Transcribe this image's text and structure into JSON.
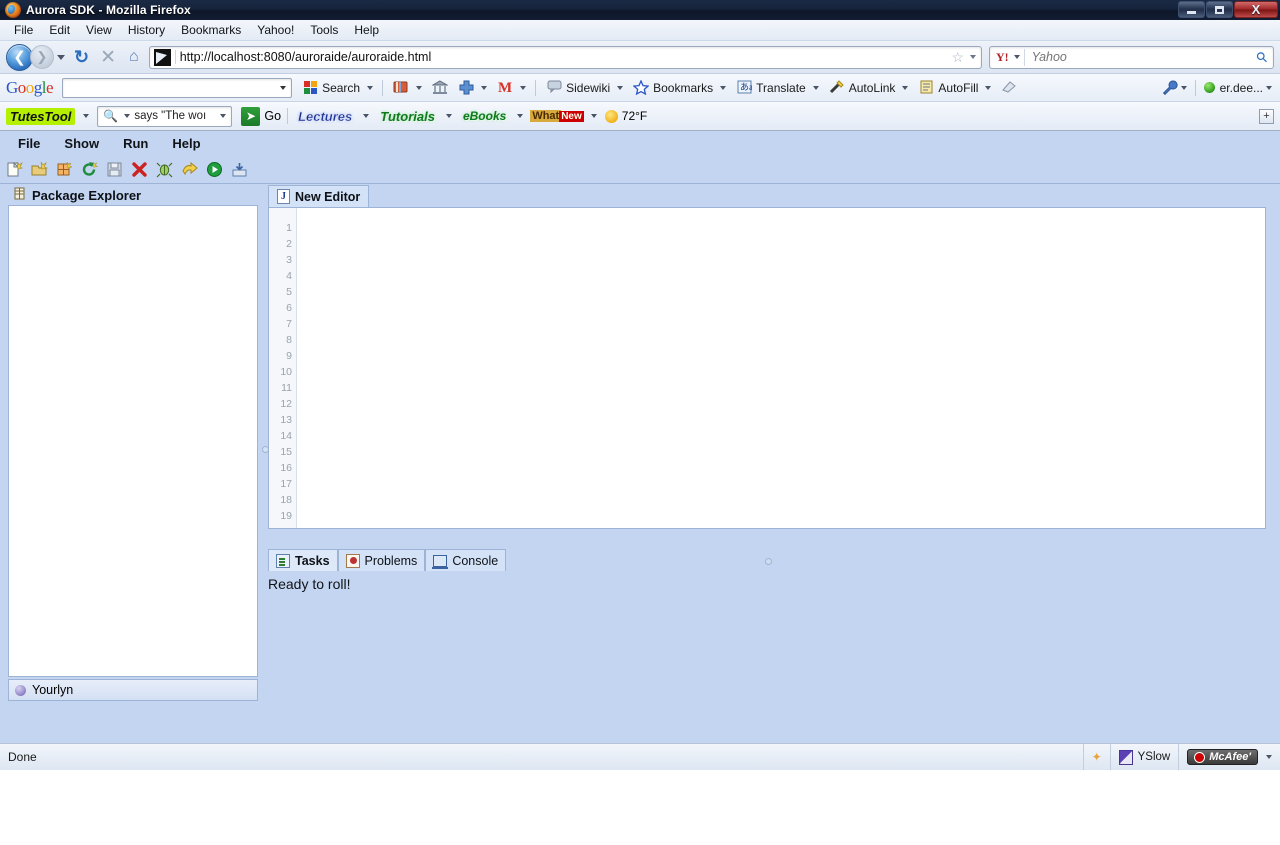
{
  "window": {
    "title": "Aurora SDK - Mozilla Firefox",
    "app_icon": "firefox-icon",
    "controls": {
      "minimize": "–",
      "maximize": "❐",
      "close": "X"
    }
  },
  "browser": {
    "menubar": [
      {
        "label": "File"
      },
      {
        "label": "Edit"
      },
      {
        "label": "View"
      },
      {
        "label": "History"
      },
      {
        "label": "Bookmarks"
      },
      {
        "label": "Yahoo!"
      },
      {
        "label": "Tools"
      },
      {
        "label": "Help"
      }
    ],
    "nav": {
      "back_icon": "❮",
      "forward_icon": "❯",
      "reload_icon": "↻",
      "stop_icon": "✕",
      "home_icon": "⌂",
      "url": "http://localhost:8080/auroraide/auroraide.html",
      "star_icon": "☆"
    },
    "search": {
      "engine": "Yahoo!",
      "engine_icon": "Y!",
      "placeholder": "Yahoo",
      "value": "",
      "go_icon": "⚲"
    }
  },
  "google_toolbar": {
    "logo": {
      "g1": "G",
      "o1": "o",
      "o2": "o",
      "g2": "g",
      "l": "l",
      "e": "e"
    },
    "search_value": "",
    "items": [
      {
        "label": "Search",
        "icon": "google-g-icon"
      },
      {
        "label": "",
        "icon": "bookmarks-book-icon"
      },
      {
        "label": "",
        "icon": "bank-icon"
      },
      {
        "label": "",
        "icon": "plus-box-icon"
      },
      {
        "label": "",
        "icon": "gmail-m-icon"
      },
      {
        "label": "Sidewiki",
        "icon": "sidewiki-icon"
      },
      {
        "label": "Bookmarks",
        "icon": "star-icon"
      },
      {
        "label": "Translate",
        "icon": "translate-icon"
      },
      {
        "label": "AutoLink",
        "icon": "autolink-wand-icon"
      },
      {
        "label": "AutoFill",
        "icon": "autofill-form-icon"
      },
      {
        "label": "",
        "icon": "eraser-icon"
      }
    ],
    "right": {
      "settings_icon": "wrench-icon",
      "account": "er.dee..."
    }
  },
  "tutes_toolbar": {
    "logo": "TutesTool",
    "search_value": "says \"The woı",
    "search_icon": "magnifier-icon",
    "go_label": "Go",
    "links": [
      {
        "label": "Lectures",
        "style": "lectures"
      },
      {
        "label": "Tutorials",
        "style": "tutorials"
      },
      {
        "label": "eBooks",
        "style": "ebooks"
      }
    ],
    "whats_new": {
      "what": "What",
      "new": "New"
    },
    "weather": {
      "icon": "sun-icon",
      "temp": "72°F"
    },
    "expand_icon": "+"
  },
  "ide": {
    "menubar": [
      {
        "label": "File"
      },
      {
        "label": "Show"
      },
      {
        "label": "Run"
      },
      {
        "label": "Help"
      }
    ],
    "toolbar": [
      {
        "name": "new-file-icon"
      },
      {
        "name": "open-file-icon"
      },
      {
        "name": "new-package-icon"
      },
      {
        "name": "refresh-icon"
      },
      {
        "name": "save-icon"
      },
      {
        "name": "delete-icon"
      },
      {
        "name": "debug-icon"
      },
      {
        "name": "run-next-icon"
      },
      {
        "name": "run-icon"
      },
      {
        "name": "export-icon"
      }
    ],
    "package_explorer": {
      "title": "Package Explorer",
      "icon": "package-icon",
      "tree_items": [],
      "status": {
        "icon": "yourlyn-icon",
        "label": "Yourlyn"
      }
    },
    "editor": {
      "tabs": [
        {
          "label": "New Editor",
          "icon": "java-doc-icon",
          "active": true
        }
      ],
      "line_numbers": [
        1,
        2,
        3,
        4,
        5,
        6,
        7,
        8,
        9,
        10,
        11,
        12,
        13,
        14,
        15,
        16,
        17,
        18,
        19
      ],
      "content": ""
    },
    "bottom_panel": {
      "tabs": [
        {
          "label": "Tasks",
          "icon": "tasks-icon",
          "active": true
        },
        {
          "label": "Problems",
          "icon": "problems-icon",
          "active": false
        },
        {
          "label": "Console",
          "icon": "console-icon",
          "active": false
        }
      ],
      "message": "Ready to roll!"
    }
  },
  "statusbar": {
    "text": "Done",
    "items": [
      {
        "label": "YSlow",
        "icon": "yslow-icon"
      },
      {
        "label": "McAfee'",
        "icon": "mcafee-icon"
      }
    ],
    "dropdown_icon": "▼"
  },
  "colors": {
    "ide_background": "#c3d5f0",
    "editor_background": "#ffffff",
    "title_bar": "#16233b",
    "accent": "#2a6fc0"
  }
}
